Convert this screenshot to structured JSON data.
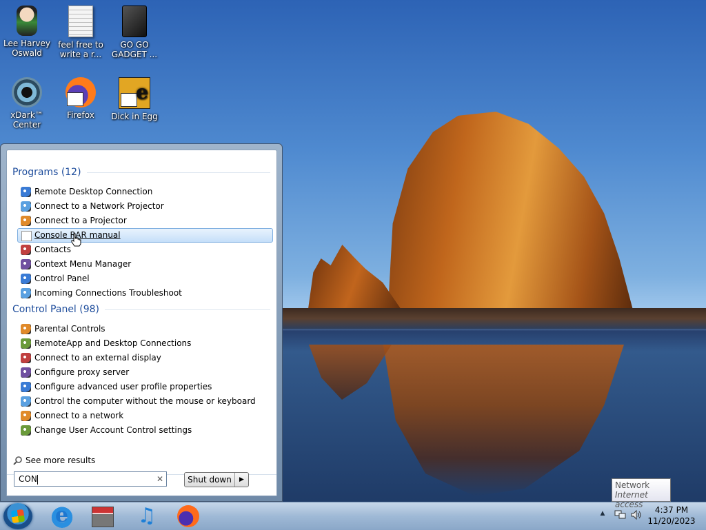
{
  "desktop": {
    "icons": [
      {
        "label": "Lee Harvey Oswald",
        "icon": "doll-icon"
      },
      {
        "label": "feel free to write a r...",
        "icon": "text-document-icon"
      },
      {
        "label": "GO GO GADGET ...",
        "icon": "gadget-icon"
      },
      {
        "label": "xDark™ Center",
        "icon": "xdark-center-icon"
      },
      {
        "label": "Firefox",
        "icon": "firefox-icon"
      },
      {
        "label": "Dick in Egg",
        "icon": "egg-app-icon"
      }
    ]
  },
  "start_menu": {
    "groups": [
      {
        "title": "Programs (12)",
        "items": [
          {
            "label": "Remote Desktop Connection",
            "icon": "remote-desktop-icon"
          },
          {
            "label": "Connect to a Network Projector",
            "icon": "network-projector-icon"
          },
          {
            "label": "Connect to a Projector",
            "icon": "projector-icon"
          },
          {
            "label": "Console RAR manual",
            "icon": "document-icon",
            "selected": true
          },
          {
            "label": "Contacts",
            "icon": "contacts-icon"
          },
          {
            "label": "Context Menu Manager",
            "icon": "context-menu-icon"
          },
          {
            "label": "Control Panel",
            "icon": "control-panel-icon"
          },
          {
            "label": "Incoming Connections Troubleshoot",
            "icon": "troubleshoot-icon"
          }
        ]
      },
      {
        "title": "Control Panel (98)",
        "items": [
          {
            "label": "Parental Controls",
            "icon": "parental-controls-icon"
          },
          {
            "label": "RemoteApp and Desktop Connections",
            "icon": "remoteapp-icon"
          },
          {
            "label": "Connect to an external display",
            "icon": "display-icon"
          },
          {
            "label": "Configure proxy server",
            "icon": "proxy-icon"
          },
          {
            "label": "Configure advanced user profile properties",
            "icon": "user-profile-icon"
          },
          {
            "label": "Control the computer without the mouse or keyboard",
            "icon": "ease-of-access-icon"
          },
          {
            "label": "Connect to a network",
            "icon": "network-icon"
          },
          {
            "label": "Change User Account Control settings",
            "icon": "uac-icon"
          }
        ]
      }
    ],
    "see_more": "See more results",
    "search": {
      "value": "CON"
    },
    "shutdown_label": "Shut down"
  },
  "taskbar": {
    "pinned": [
      "internet-explorer-icon",
      "store-icon",
      "music-icon",
      "firefox-icon"
    ],
    "clock": {
      "time": "4:37 PM",
      "date": "11/20/2023"
    },
    "tooltip": {
      "title": "Network",
      "subtitle": "Internet access"
    }
  },
  "colors": {
    "group_heading": "#1e4d9c",
    "selection": "#c5dff9",
    "taskbar": "#9fb9d6"
  }
}
